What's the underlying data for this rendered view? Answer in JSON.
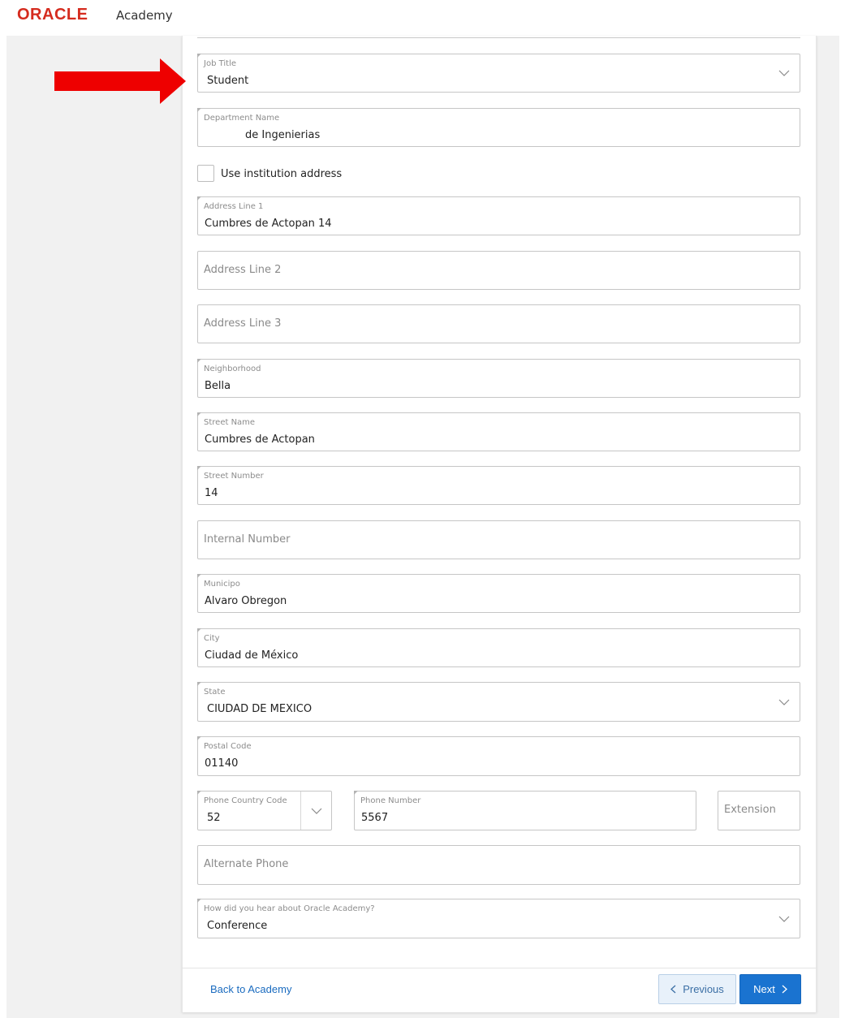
{
  "header": {
    "brand": "ORACLE",
    "product": "Academy"
  },
  "annotation": {
    "arrow_color": "#ee0000",
    "arrow_icon": "right-arrow-icon"
  },
  "form": {
    "job_title": {
      "label": "Job Title",
      "value": "Student"
    },
    "department_name": {
      "label": "Department Name",
      "value": "de Ingenierias"
    },
    "use_institution_address": {
      "label": "Use institution address",
      "checked": false
    },
    "address_line_1": {
      "label": "Address Line 1",
      "value": "Cumbres de Actopan 14"
    },
    "address_line_2": {
      "placeholder": "Address Line 2"
    },
    "address_line_3": {
      "placeholder": "Address Line 3"
    },
    "neighborhood": {
      "label": "Neighborhood",
      "value": "Bella"
    },
    "street_name": {
      "label": "Street Name",
      "value": "Cumbres de Actopan"
    },
    "street_number": {
      "label": "Street Number",
      "value": "14"
    },
    "internal_number": {
      "placeholder": "Internal Number"
    },
    "municipio": {
      "label": "Municipo",
      "value": "Alvaro Obregon"
    },
    "city": {
      "label": "City",
      "value": "Ciudad de México"
    },
    "state": {
      "label": "State",
      "value": "CIUDAD DE MEXICO"
    },
    "postal_code": {
      "label": "Postal Code",
      "value": "01140"
    },
    "phone_country_code": {
      "label": "Phone Country Code",
      "value": "52"
    },
    "phone_number": {
      "label": "Phone Number",
      "value": "5567"
    },
    "extension": {
      "placeholder": "Extension"
    },
    "alternate_phone": {
      "placeholder": "Alternate Phone"
    },
    "heard_about": {
      "label": "How did you hear about Oracle Academy?",
      "value": "Conference"
    }
  },
  "footer": {
    "back_link": "Back to Academy",
    "previous_label": "Previous",
    "next_label": "Next"
  },
  "colors": {
    "brand_red": "#d52b1e",
    "primary_blue": "#1a73d0",
    "link_blue": "#1a6bbf"
  }
}
